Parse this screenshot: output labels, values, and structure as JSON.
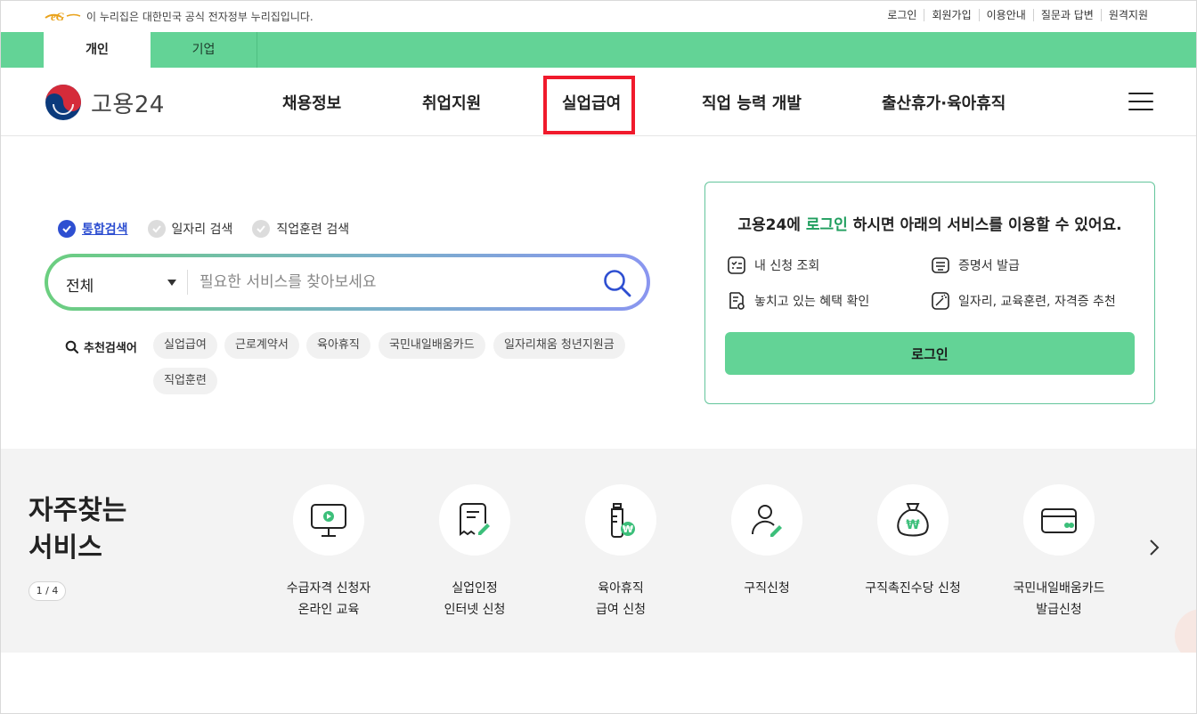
{
  "top_bar": {
    "gov_notice": "이 누리집은 대한민국 공식 전자정부 누리집입니다.",
    "links": [
      "로그인",
      "회원가입",
      "이용안내",
      "질문과 답변",
      "원격지원"
    ]
  },
  "tabs": [
    {
      "label": "개인",
      "active": true
    },
    {
      "label": "기업",
      "active": false
    }
  ],
  "nav": {
    "logo_text": "고용24",
    "menu": [
      "채용정보",
      "취업지원",
      "실업급여",
      "직업 능력 개발",
      "출산휴가·육아휴직"
    ],
    "highlighted_menu": "실업급여",
    "highlight_color": "#f01a2c"
  },
  "search": {
    "options": [
      {
        "label": "통합검색",
        "checked": true
      },
      {
        "label": "일자리 검색",
        "checked": false
      },
      {
        "label": "직업훈련 검색",
        "checked": false
      }
    ],
    "category": "전체",
    "placeholder": "필요한 서비스를 찾아보세요",
    "recommend_label": "추천검색어",
    "keywords": [
      "실업급여",
      "근로계약서",
      "육아휴직",
      "국민내일배움카드",
      "일자리채움 청년지원금",
      "직업훈련"
    ]
  },
  "login_panel": {
    "title_prefix": "고용24에 ",
    "title_highlight": "로그인",
    "title_suffix": " 하시면 아래의 서비스를 이용할 수 있어요.",
    "services": [
      "내 신청 조회",
      "증명서 발급",
      "놓치고 있는 혜택 확인",
      "일자리, 교육훈련, 자격증 추천"
    ],
    "button": "로그인"
  },
  "frequent": {
    "title_line1": "자주찾는",
    "title_line2": "서비스",
    "pager": "1 / 4",
    "items": [
      {
        "line1": "수급자격 신청자",
        "line2": "온라인 교육",
        "icon": "monitor-play-icon"
      },
      {
        "line1": "실업인정",
        "line2": "인터넷 신청",
        "icon": "document-pen-icon"
      },
      {
        "line1": "육아휴직",
        "line2": "급여 신청",
        "icon": "baby-bottle-won-icon"
      },
      {
        "line1": "구직신청",
        "line2": "",
        "icon": "person-pen-icon"
      },
      {
        "line1": "구직촉진수당 신청",
        "line2": "",
        "icon": "money-bag-won-icon"
      },
      {
        "line1": "국민내일배움카드",
        "line2": "발급신청",
        "icon": "card-icon"
      }
    ]
  },
  "colors": {
    "brand_green": "#63d396",
    "accent_blue": "#2e4fd1",
    "text_green": "#1f9e5e"
  }
}
